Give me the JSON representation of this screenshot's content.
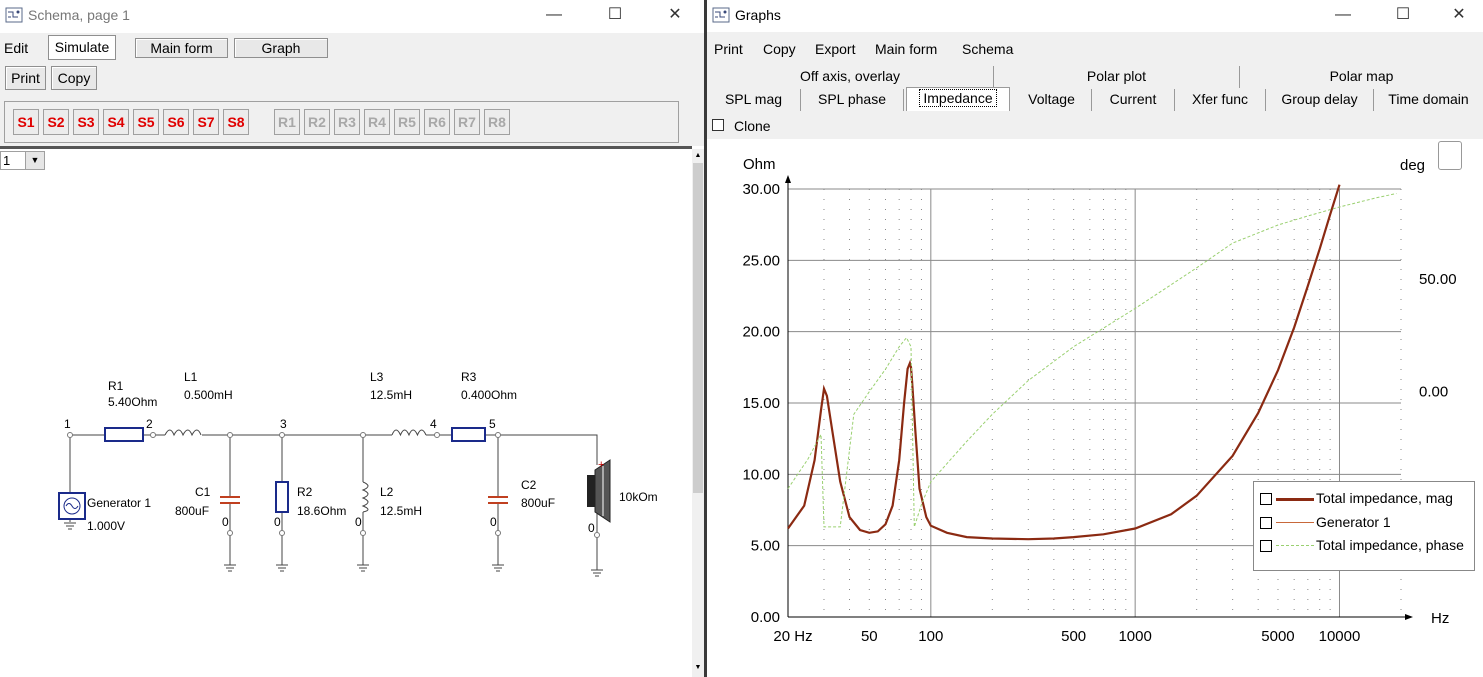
{
  "schema_window": {
    "title": "Schema, page 1",
    "menu": [
      "Edit",
      "Simulate"
    ],
    "buttons": {
      "main_form": "Main form",
      "graph": "Graph",
      "print": "Print",
      "copy": "Copy"
    },
    "sim_buttons": [
      "S1",
      "S2",
      "S3",
      "S4",
      "S5",
      "S6",
      "S7",
      "S8"
    ],
    "ref_buttons": [
      "R1",
      "R2",
      "R3",
      "R4",
      "R5",
      "R6",
      "R7",
      "R8"
    ],
    "page_select": "1",
    "circuit": {
      "nodes": [
        "1",
        "2",
        "3",
        "4",
        "5"
      ],
      "R1": {
        "name": "R1",
        "value": "5.40Ohm"
      },
      "L1": {
        "name": "L1",
        "value": "0.500mH"
      },
      "L3": {
        "name": "L3",
        "value": "12.5mH"
      },
      "R3": {
        "name": "R3",
        "value": "0.400Ohm"
      },
      "C1": {
        "name": "C1",
        "value": "800uF"
      },
      "R2": {
        "name": "R2",
        "value": "18.6Ohm"
      },
      "L2": {
        "name": "L2",
        "value": "12.5mH"
      },
      "C2": {
        "name": "C2",
        "value": "800uF"
      },
      "generator": {
        "name": "Generator 1",
        "value": "1.000V"
      },
      "speaker": {
        "value": "10kOm"
      },
      "ground_label": "0"
    }
  },
  "graphs_window": {
    "title": "Graphs",
    "menu": [
      "Print",
      "Copy",
      "Export",
      "Main form",
      "Schema"
    ],
    "tabs_top": [
      "Off axis, overlay",
      "Polar plot",
      "Polar map"
    ],
    "tabs_bottom": [
      "SPL mag",
      "SPL phase",
      "Impedance",
      "Voltage",
      "Current",
      "Xfer func",
      "Group delay",
      "Time domain"
    ],
    "selected_tab": "Impedance",
    "clone_label": "Clone",
    "colors": {
      "mag": "#8b2a12",
      "generator": "#c8683a",
      "phase": "#9ad070"
    }
  },
  "chart_data": {
    "type": "line",
    "ylabel": "Ohm",
    "y2label": "deg",
    "xlabel": "Hz",
    "xscale": "log",
    "xlim": [
      20,
      20000
    ],
    "ylim": [
      0,
      30
    ],
    "y2lim": [
      -100,
      90
    ],
    "x_tick_labels": [
      "20 Hz",
      "50",
      "100",
      "500",
      "1000",
      "5000",
      "10000"
    ],
    "x_tick_values": [
      20,
      50,
      100,
      500,
      1000,
      5000,
      10000
    ],
    "y_tick_labels": [
      "0.00",
      "5.00",
      "10.00",
      "15.00",
      "20.00",
      "25.00",
      "30.00"
    ],
    "y2_tick_labels": [
      "0.00",
      "50.00"
    ],
    "y2_tick_values": [
      0,
      50
    ],
    "series": [
      {
        "name": "Total impedance, mag",
        "axis": "left",
        "x": [
          20,
          24,
          27,
          29,
          30,
          31,
          33,
          36,
          40,
          45,
          50,
          55,
          60,
          65,
          70,
          74,
          77,
          79,
          80,
          81,
          84,
          88,
          95,
          100,
          120,
          150,
          200,
          300,
          400,
          500,
          700,
          1000,
          1500,
          2000,
          3000,
          4000,
          5000,
          6000,
          7000,
          8000,
          9000,
          10000
        ],
        "y": [
          6.2,
          7.8,
          11,
          14.5,
          16,
          15.5,
          13,
          9.5,
          7,
          6.1,
          5.9,
          6,
          6.5,
          7.8,
          11,
          15,
          17.4,
          17.8,
          17.5,
          16.5,
          13,
          9,
          7,
          6.4,
          5.9,
          5.6,
          5.5,
          5.45,
          5.5,
          5.6,
          5.8,
          6.2,
          7.2,
          8.5,
          11.3,
          14.3,
          17.3,
          20.3,
          23.2,
          25.8,
          28.2,
          30.3
        ]
      },
      {
        "name": "Generator 1",
        "axis": "left",
        "x": [],
        "y": []
      },
      {
        "name": "Total impedance, phase",
        "axis": "right",
        "x": [
          20,
          25,
          29,
          30,
          32,
          36,
          42,
          50,
          60,
          70,
          76,
          80,
          83,
          90,
          100,
          150,
          200,
          300,
          500,
          1000,
          2000,
          3000,
          5000,
          7000,
          10000,
          15000,
          19000
        ],
        "y": [
          -43,
          -30,
          -19,
          -60,
          -60,
          -60,
          -10,
          0,
          10,
          20,
          24,
          20,
          -60,
          -50,
          -40,
          -22,
          -10,
          5,
          20,
          37,
          55,
          66,
          74,
          78,
          82,
          86,
          88
        ]
      }
    ],
    "legend_position": "lower-right",
    "grid": true
  }
}
